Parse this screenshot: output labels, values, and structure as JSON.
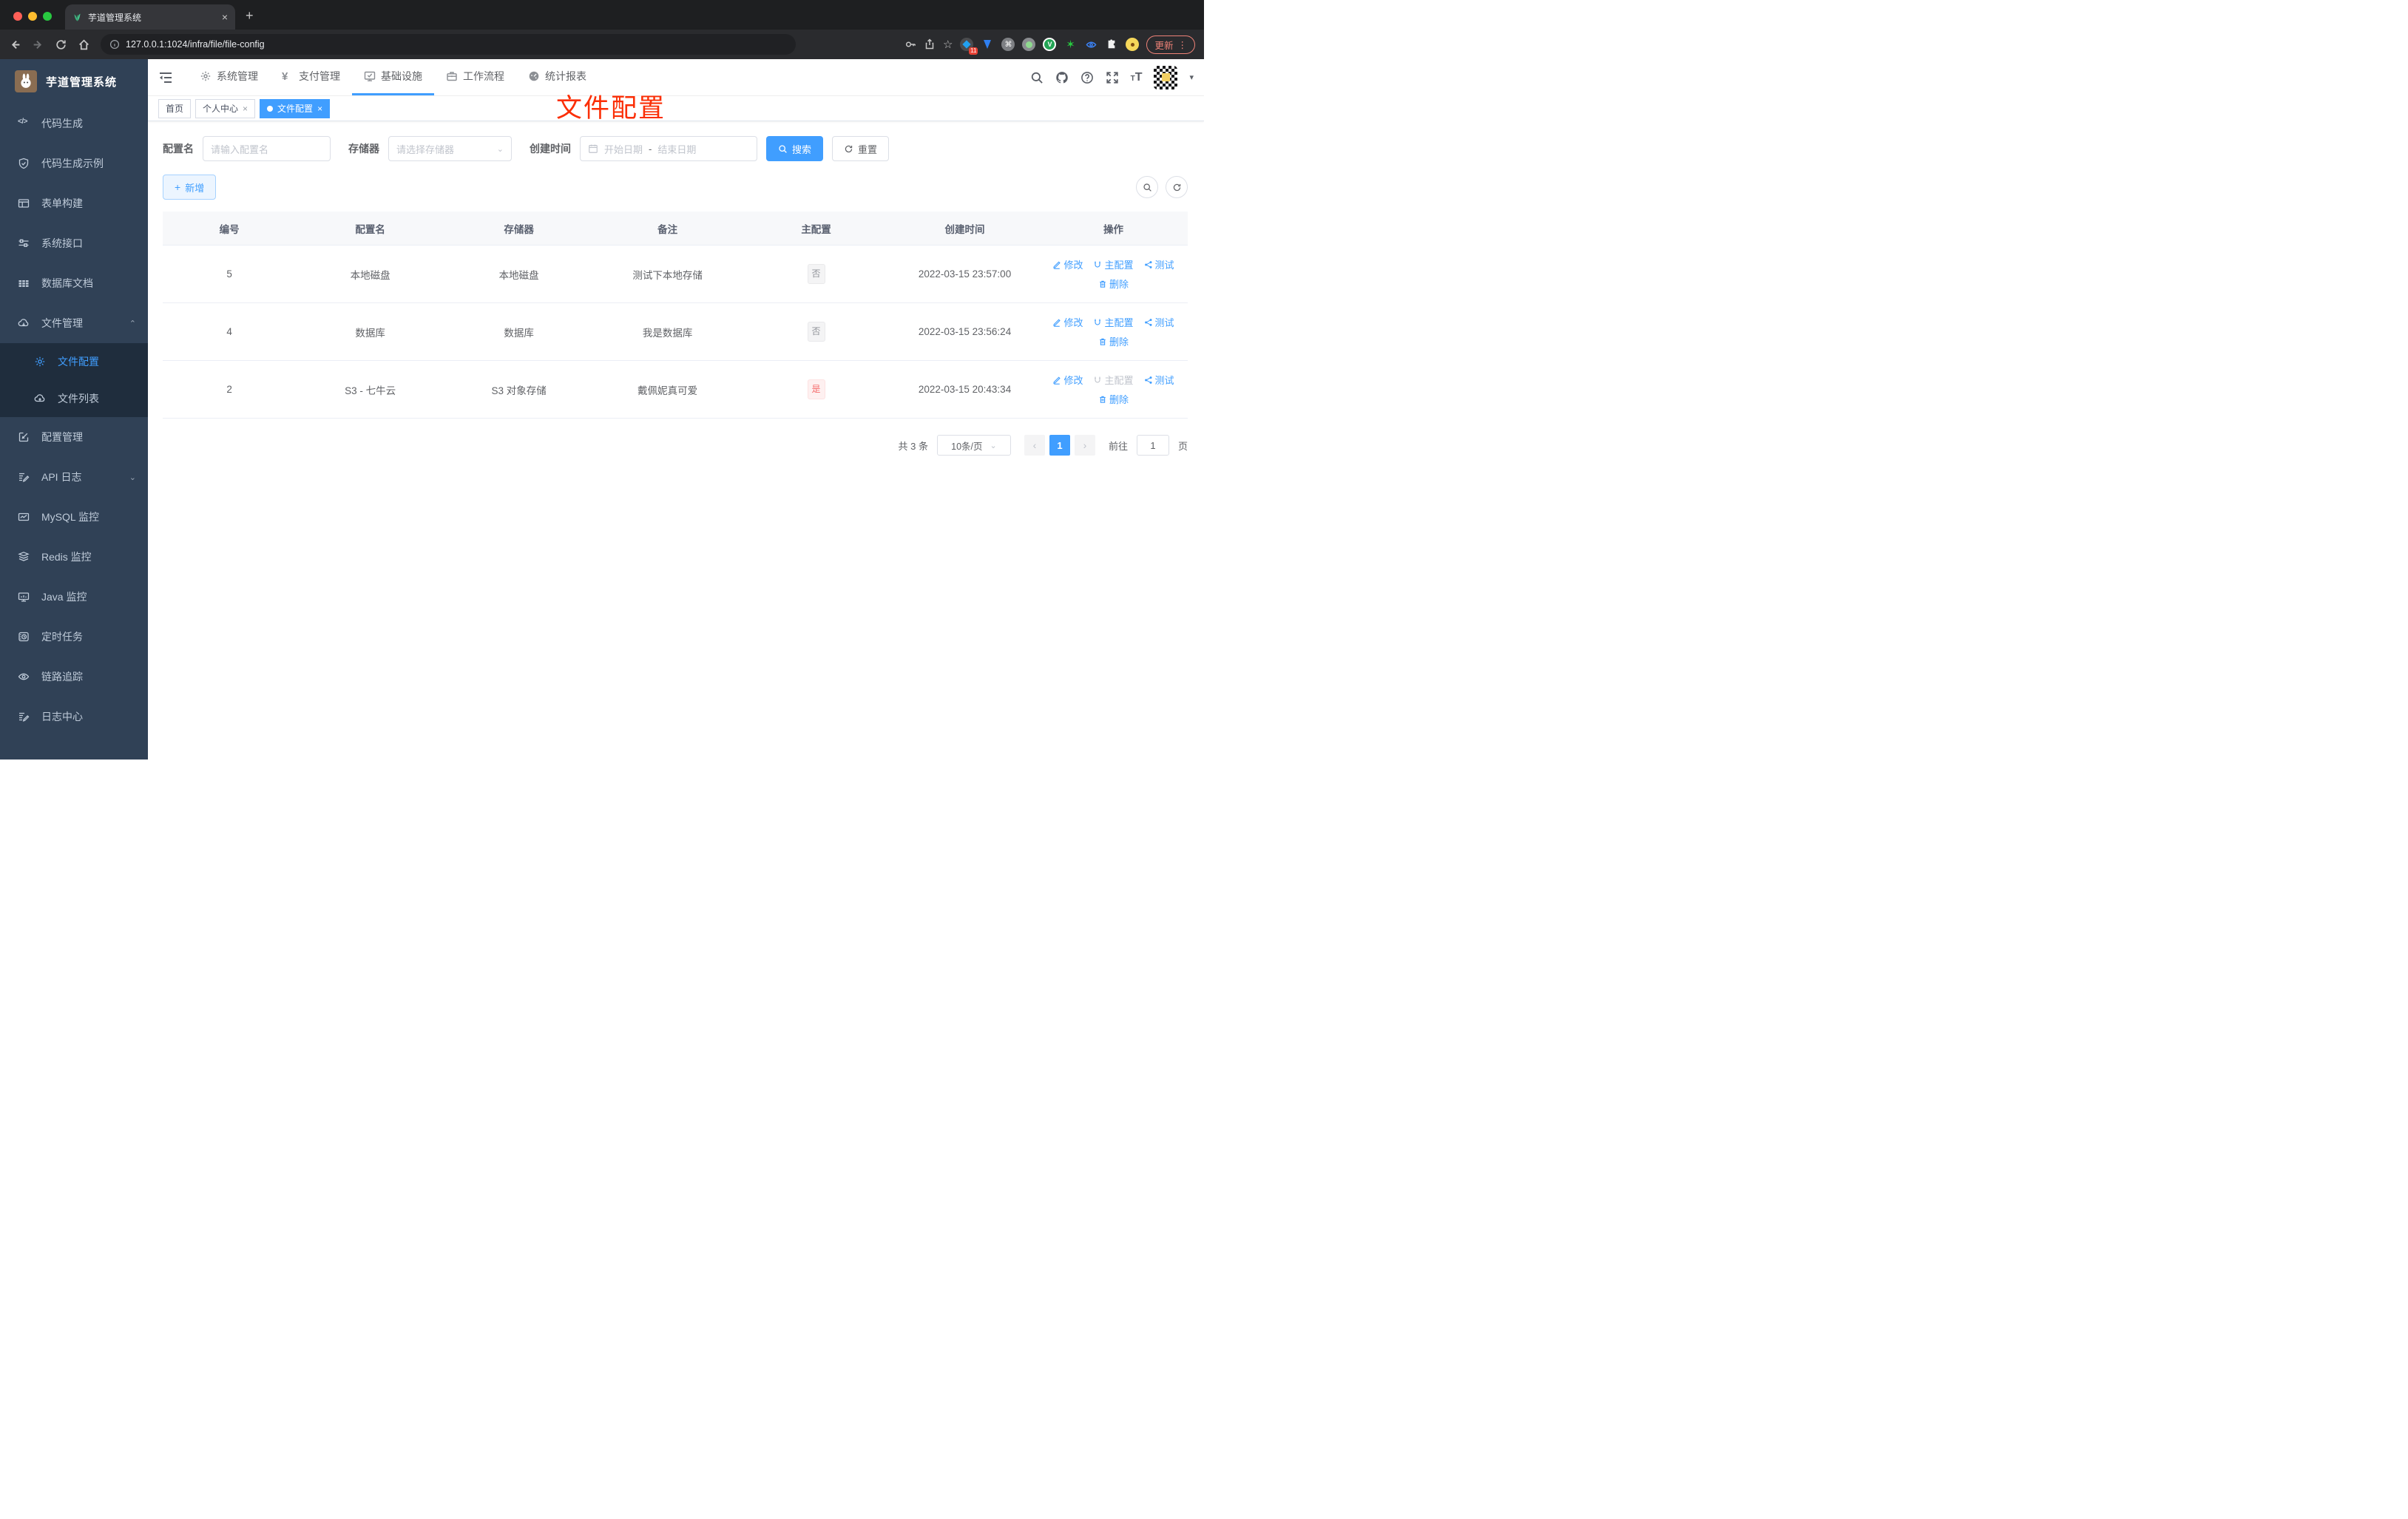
{
  "browser": {
    "tab_title": "芋道管理系统",
    "url": "127.0.0.1:1024/infra/file/file-config",
    "ext_badge": "11",
    "update_label": "更新"
  },
  "sidebar": {
    "title": "芋道管理系统",
    "items": [
      {
        "label": "代码生成"
      },
      {
        "label": "代码生成示例"
      },
      {
        "label": "表单构建"
      },
      {
        "label": "系统接口"
      },
      {
        "label": "数据库文档"
      },
      {
        "label": "文件管理"
      },
      {
        "label": "文件配置"
      },
      {
        "label": "文件列表"
      },
      {
        "label": "配置管理"
      },
      {
        "label": "API 日志"
      },
      {
        "label": "MySQL 监控"
      },
      {
        "label": "Redis 监控"
      },
      {
        "label": "Java 监控"
      },
      {
        "label": "定时任务"
      },
      {
        "label": "链路追踪"
      },
      {
        "label": "日志中心"
      }
    ]
  },
  "navbar": {
    "items": [
      "系统管理",
      "支付管理",
      "基础设施",
      "工作流程",
      "统计报表"
    ]
  },
  "tags": [
    {
      "label": "首页"
    },
    {
      "label": "个人中心"
    },
    {
      "label": "文件配置"
    }
  ],
  "annotation": "文件配置",
  "search": {
    "name_label": "配置名",
    "name_placeholder": "请输入配置名",
    "storage_label": "存储器",
    "storage_placeholder": "请选择存储器",
    "date_label": "创建时间",
    "date_start_placeholder": "开始日期",
    "date_separator": "-",
    "date_end_placeholder": "结束日期",
    "search_button": "搜索",
    "reset_button": "重置",
    "add_button": "新增"
  },
  "table": {
    "columns": [
      "编号",
      "配置名",
      "存储器",
      "备注",
      "主配置",
      "创建时间",
      "操作"
    ],
    "actions": {
      "edit": "修改",
      "master": "主配置",
      "test": "测试",
      "delete": "删除"
    },
    "rows": [
      {
        "id": "5",
        "name": "本地磁盘",
        "storage": "本地磁盘",
        "remark": "测试下本地存储",
        "master": "否",
        "created": "2022-03-15 23:57:00"
      },
      {
        "id": "4",
        "name": "数据库",
        "storage": "数据库",
        "remark": "我是数据库",
        "master": "否",
        "created": "2022-03-15 23:56:24"
      },
      {
        "id": "2",
        "name": "S3 - 七牛云",
        "storage": "S3 对象存储",
        "remark": "戴佩妮真可爱",
        "master": "是",
        "created": "2022-03-15 20:43:34"
      }
    ]
  },
  "pagination": {
    "total": "共 3 条",
    "page_size": "10条/页",
    "prev": "‹",
    "current": "1",
    "next": "›",
    "goto_label": "前往",
    "goto_value": "1",
    "page_unit": "页"
  }
}
